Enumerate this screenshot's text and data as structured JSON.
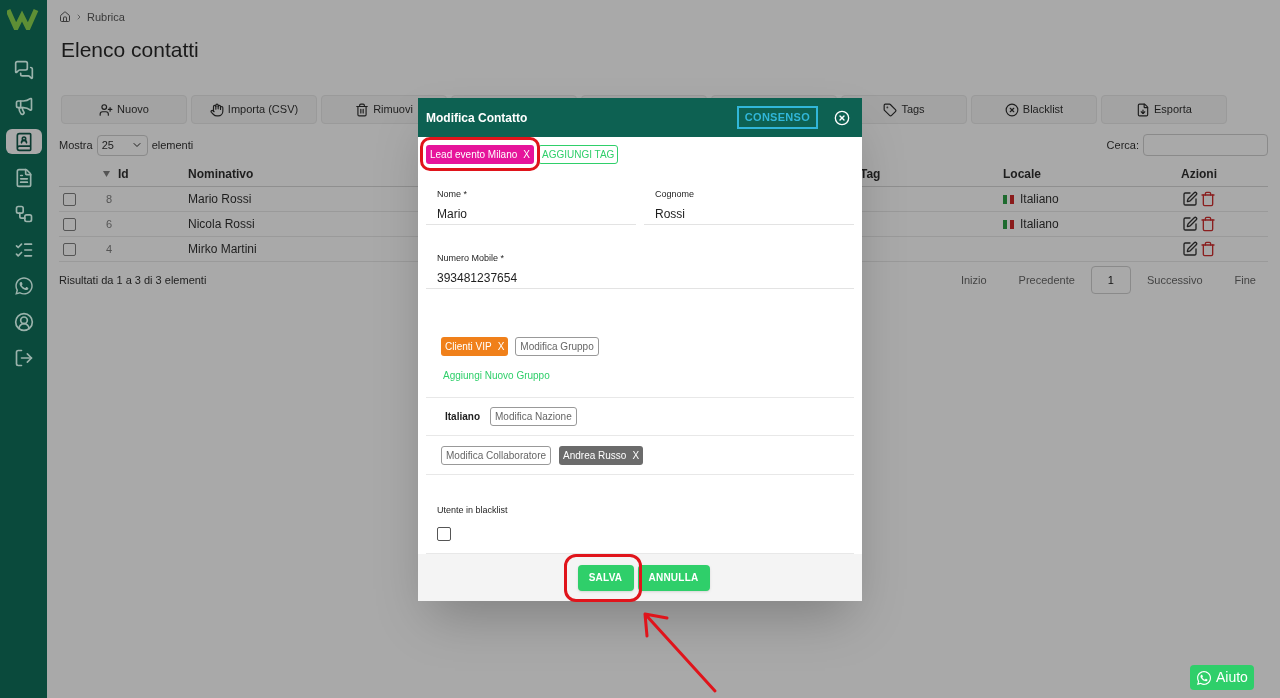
{
  "sidebar": [
    {
      "selected": false
    },
    {
      "selected": false
    },
    {
      "selected": true
    },
    {
      "selected": false
    },
    {
      "selected": false
    },
    {
      "selected": false
    },
    {
      "selected": false
    },
    {
      "selected": false
    },
    {
      "selected": false
    }
  ],
  "breadcrumb": "Rubrica",
  "page_title": "Elenco contatti",
  "toolbar": [
    "Nuovo",
    "Importa (CSV)",
    "Rimuovi",
    "Tags",
    "Blacklist",
    "Esporta"
  ],
  "length_menu": {
    "prefix": "Mostra",
    "value": "25",
    "suffix": "elementi"
  },
  "search": {
    "label": "Cerca:"
  },
  "table": {
    "columns": [
      "Id",
      "Nominativo",
      "Tag",
      "Locale",
      "Azioni"
    ],
    "rows": [
      {
        "id": "8",
        "name": "Mario Rossi",
        "locale": "Italiano",
        "checked": false
      },
      {
        "id": "6",
        "name": "Nicola Rossi",
        "locale": "Italiano",
        "checked": false
      },
      {
        "id": "4",
        "name": "Mirko Martini",
        "locale": "",
        "checked": false
      }
    ]
  },
  "summary": "Risultati da 1 a 3 di 3 elementi",
  "pagination": [
    {
      "label": "Inizio",
      "selected": false
    },
    {
      "label": "Precedente",
      "selected": false
    },
    {
      "label": "1",
      "selected": true
    },
    {
      "label": "Successivo",
      "selected": false
    },
    {
      "label": "Fine",
      "selected": false
    }
  ],
  "modal": {
    "title": "Modifica Contatto",
    "consent_button": "CONSENSO",
    "tags": [
      {
        "label": "Lead evento Milano",
        "remove": "X",
        "color": "#e6149b"
      }
    ],
    "add_tag": "AGGIUNGI TAG",
    "fields": [
      {
        "label": "Nome *",
        "value": "Mario"
      },
      {
        "label": "Cognome",
        "value": "Rossi"
      },
      {
        "label": "Numero Mobile *",
        "value": "393481237654"
      }
    ],
    "groups": [
      {
        "label": "Clienti VIP",
        "remove": "X",
        "color": "#f0801a"
      }
    ],
    "edit_group": "Modifica Gruppo",
    "add_group": "Aggiungi Nuovo Gruppo",
    "nation": "Italiano",
    "edit_nation": "Modifica Nazione",
    "edit_collaborator": "Modifica Collaboratore",
    "collaborators": [
      {
        "label": "Andrea Russo",
        "remove": "X"
      }
    ],
    "blacklist": {
      "label": "Utente in blacklist",
      "checked": false
    },
    "buttons": [
      "SALVA",
      "ANNULLA"
    ]
  },
  "help_button": "Aiuto"
}
